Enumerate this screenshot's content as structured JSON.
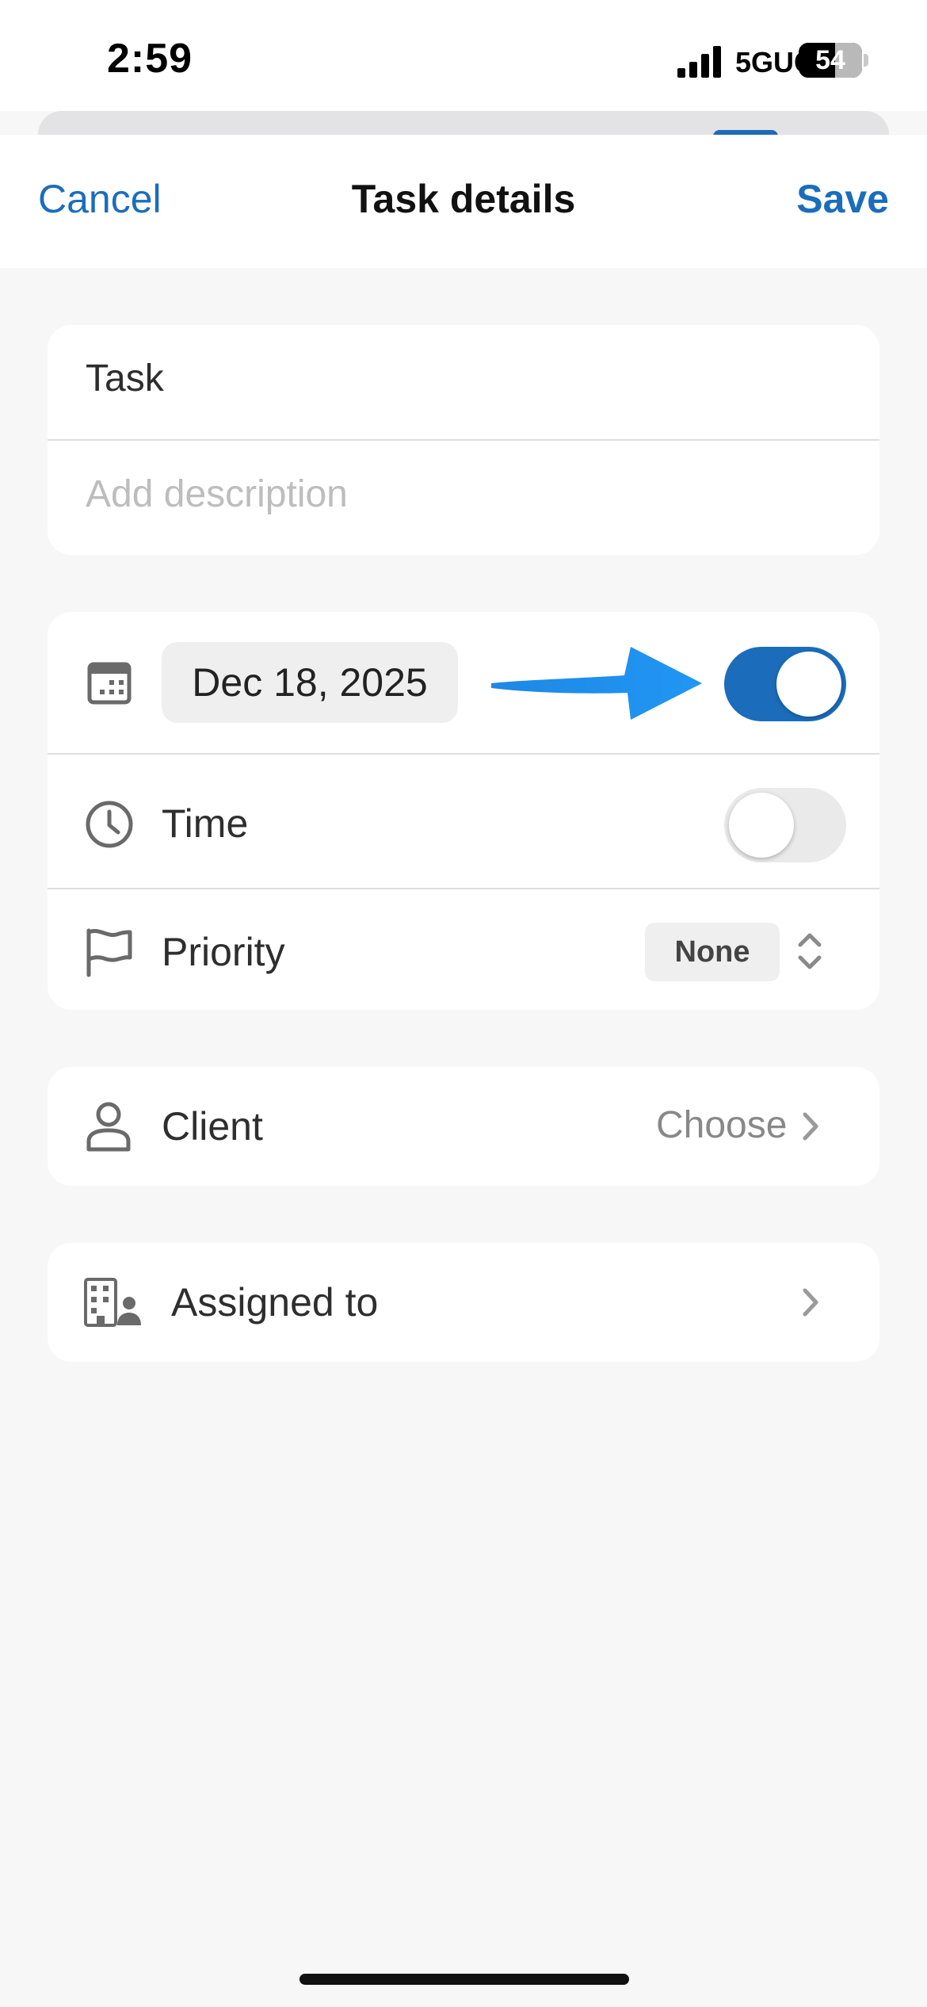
{
  "status_bar": {
    "time": "2:59",
    "network": "5GUC",
    "battery": "54"
  },
  "nav": {
    "cancel_label": "Cancel",
    "title": "Task details",
    "save_label": "Save"
  },
  "task_card": {
    "task_value": "Task",
    "description_placeholder": "Add description"
  },
  "schedule_card": {
    "date_value": "Dec 18, 2025",
    "date_toggle_on": true,
    "time_label": "Time",
    "time_toggle_on": false,
    "priority_label": "Priority",
    "priority_value": "None"
  },
  "client_card": {
    "label": "Client",
    "value": "Choose"
  },
  "assigned_card": {
    "label": "Assigned to"
  },
  "colors": {
    "accent": "#1b6dbc",
    "annotation_arrow": "#2196f3",
    "background": "#f7f7f7"
  },
  "icons": [
    "calendar-icon",
    "clock-icon",
    "flag-icon",
    "person-icon",
    "building-person-icon",
    "chevron-right-icon",
    "chevron-updown-icon"
  ]
}
